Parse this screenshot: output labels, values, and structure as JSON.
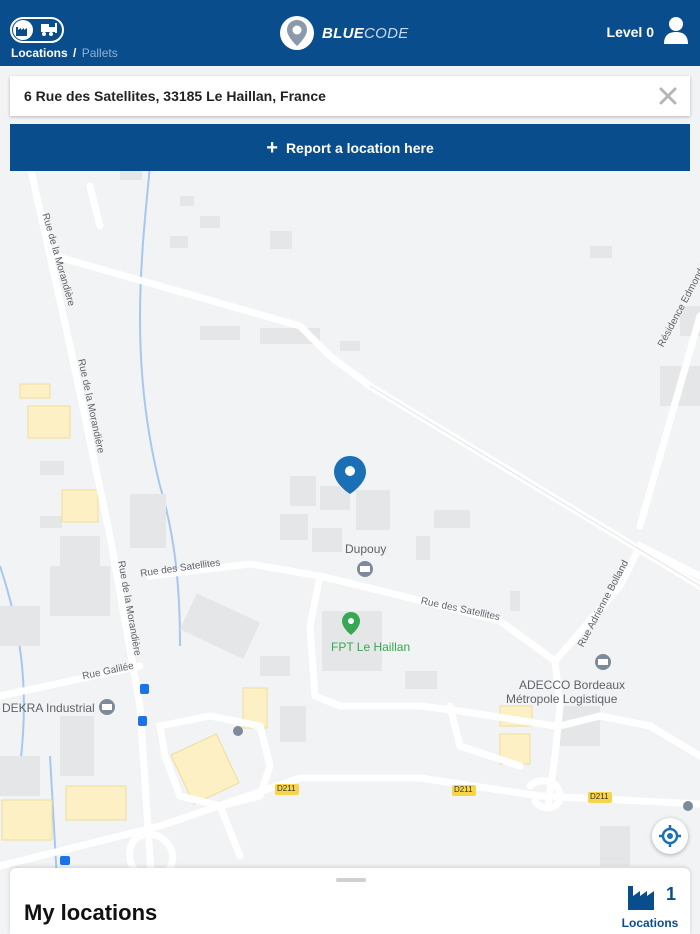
{
  "header": {
    "brand_name_bold": "BLUE",
    "brand_name_light": "CODE",
    "breadcrumb_active": "Locations",
    "breadcrumb_separator": "/",
    "breadcrumb_inactive": "Pallets",
    "level_label": "Level 0",
    "toggle_icons": [
      "factory-icon",
      "forklift-icon"
    ]
  },
  "address": {
    "value": "6 Rue des Satellites, 33185 Le Haillan, France",
    "clear_icon": "close-icon"
  },
  "report_button": {
    "label": "Report a location here",
    "icon": "plus-icon"
  },
  "map": {
    "labels": {
      "dupouy": "Dupouy",
      "fpt": "FPT Le Haillan",
      "adecco_1": "ADECCO Bordeaux",
      "adecco_2": "Métropole Logistique",
      "dekra": "DEKRA Industrial",
      "rue_sat_1": "Rue des Satellites",
      "rue_sat_2": "Rue des Satellites",
      "rue_moran_1": "Rue de la Morandière",
      "rue_moran_2": "Rue de la Morandière",
      "rue_moran_3": "Rue de la Morandière",
      "rue_galilee": "Rue Galilée",
      "rue_bolland": "Rue Adrienne Bolland",
      "rue_edmond": "Résidence Edmond Ro",
      "d211_1": "D211",
      "d211_2": "D211",
      "d211_3": "D211"
    },
    "colors": {
      "background": "#f2f3f4",
      "road": "#ffffff",
      "building": "#e6e7e9",
      "yellow_building": "#fdf0c5",
      "water": "#a6c8f0",
      "pin": "#1a6fb5",
      "green_pin": "#34a853"
    }
  },
  "bottom_sheet": {
    "title": "My locations",
    "count": "1",
    "count_label": "Locations"
  },
  "colors": {
    "primary": "#0a4d8c",
    "accent_light": "#8fb1d3"
  }
}
